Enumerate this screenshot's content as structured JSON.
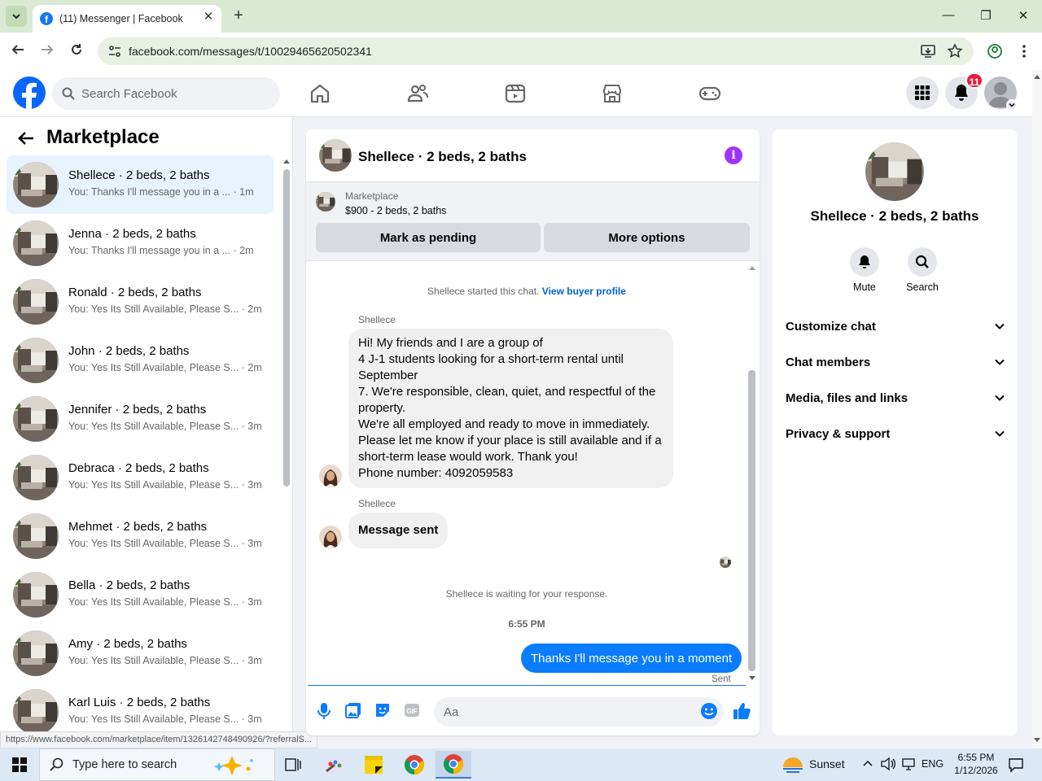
{
  "browser": {
    "tab_title": "(11) Messenger | Facebook",
    "url": "facebook.com/messages/t/10029465620502341"
  },
  "fb_header": {
    "search_placeholder": "Search Facebook",
    "notification_count": "11"
  },
  "sidebar": {
    "title": "Marketplace",
    "threads": [
      {
        "name": "Shellece · 2 beds, 2 baths",
        "preview": "You: Thanks I'll message you in a ...",
        "time": "· 1m",
        "active": true
      },
      {
        "name": "Jenna · 2 beds, 2 baths",
        "preview": "You: Thanks I'll message you in a ...",
        "time": "· 2m"
      },
      {
        "name": "Ronald · 2 beds, 2 baths",
        "preview": "You: Yes Its Still Available, Please S...",
        "time": "· 2m"
      },
      {
        "name": "John · 2 beds, 2 baths",
        "preview": "You: Yes Its Still Available, Please S...",
        "time": "· 2m"
      },
      {
        "name": "Jennifer · 2 beds, 2 baths",
        "preview": "You: Yes Its Still Available, Please S...",
        "time": "· 3m"
      },
      {
        "name": "Debraca · 2 beds, 2 baths",
        "preview": "You: Yes Its Still Available, Please S...",
        "time": "· 3m"
      },
      {
        "name": "Mehmet · 2 beds, 2 baths",
        "preview": "You: Yes Its Still Available, Please S...",
        "time": "· 3m"
      },
      {
        "name": "Bella · 2 beds, 2 baths",
        "preview": "You: Yes Its Still Available, Please S...",
        "time": "· 3m"
      },
      {
        "name": "Amy · 2 beds, 2 baths",
        "preview": "You: Yes Its Still Available, Please S...",
        "time": "· 3m"
      },
      {
        "name": "Karl Luis · 2 beds, 2 baths",
        "preview": "You: Yes Its Still Available, Please S...",
        "time": "· 3m"
      }
    ],
    "status_url": "https://www.facebook.com/marketplace/item/1326142748490926/?referralS..."
  },
  "chat": {
    "title": "Shellece · 2 beds, 2 baths",
    "listing_label": "Marketplace",
    "listing_price": "$900 - 2 beds, 2 baths",
    "mark_pending": "Mark as pending",
    "more_options": "More options",
    "started_text": "Shellece started this chat.",
    "view_profile": "View buyer profile",
    "sender": "Shellece",
    "message1": "Hi! My friends and I are a group of\n4 J-1 students looking for a short-term rental until September\n7. We're responsible, clean, quiet, and respectful of the property.\nWe're all employed and ready to move in immediately. Please let me know if your place is still available and if a short-term lease would work. Thank you!\nPhone number: 4092059583",
    "message2": "Message sent",
    "waiting_text": "Shellece is waiting for your response.",
    "time_divider": "6:55 PM",
    "outgoing": "Thanks I'll message you in a moment",
    "sent_status": "Sent",
    "input_placeholder": "Aa"
  },
  "right_panel": {
    "name": "Shellece · 2 beds, 2 baths",
    "mute": "Mute",
    "search": "Search",
    "sections": [
      "Customize chat",
      "Chat members",
      "Media, files and links",
      "Privacy & support"
    ]
  },
  "taskbar": {
    "search_placeholder": "Type here to search",
    "weather": "Sunset",
    "language": "ENG",
    "time": "6:55 PM",
    "date": "1/12/2026"
  },
  "colors": {
    "fb_blue": "#0866ff",
    "messenger_blue": "#0a7cff",
    "badge_red": "#e41e3f",
    "active_thread": "#e7f3ff"
  }
}
